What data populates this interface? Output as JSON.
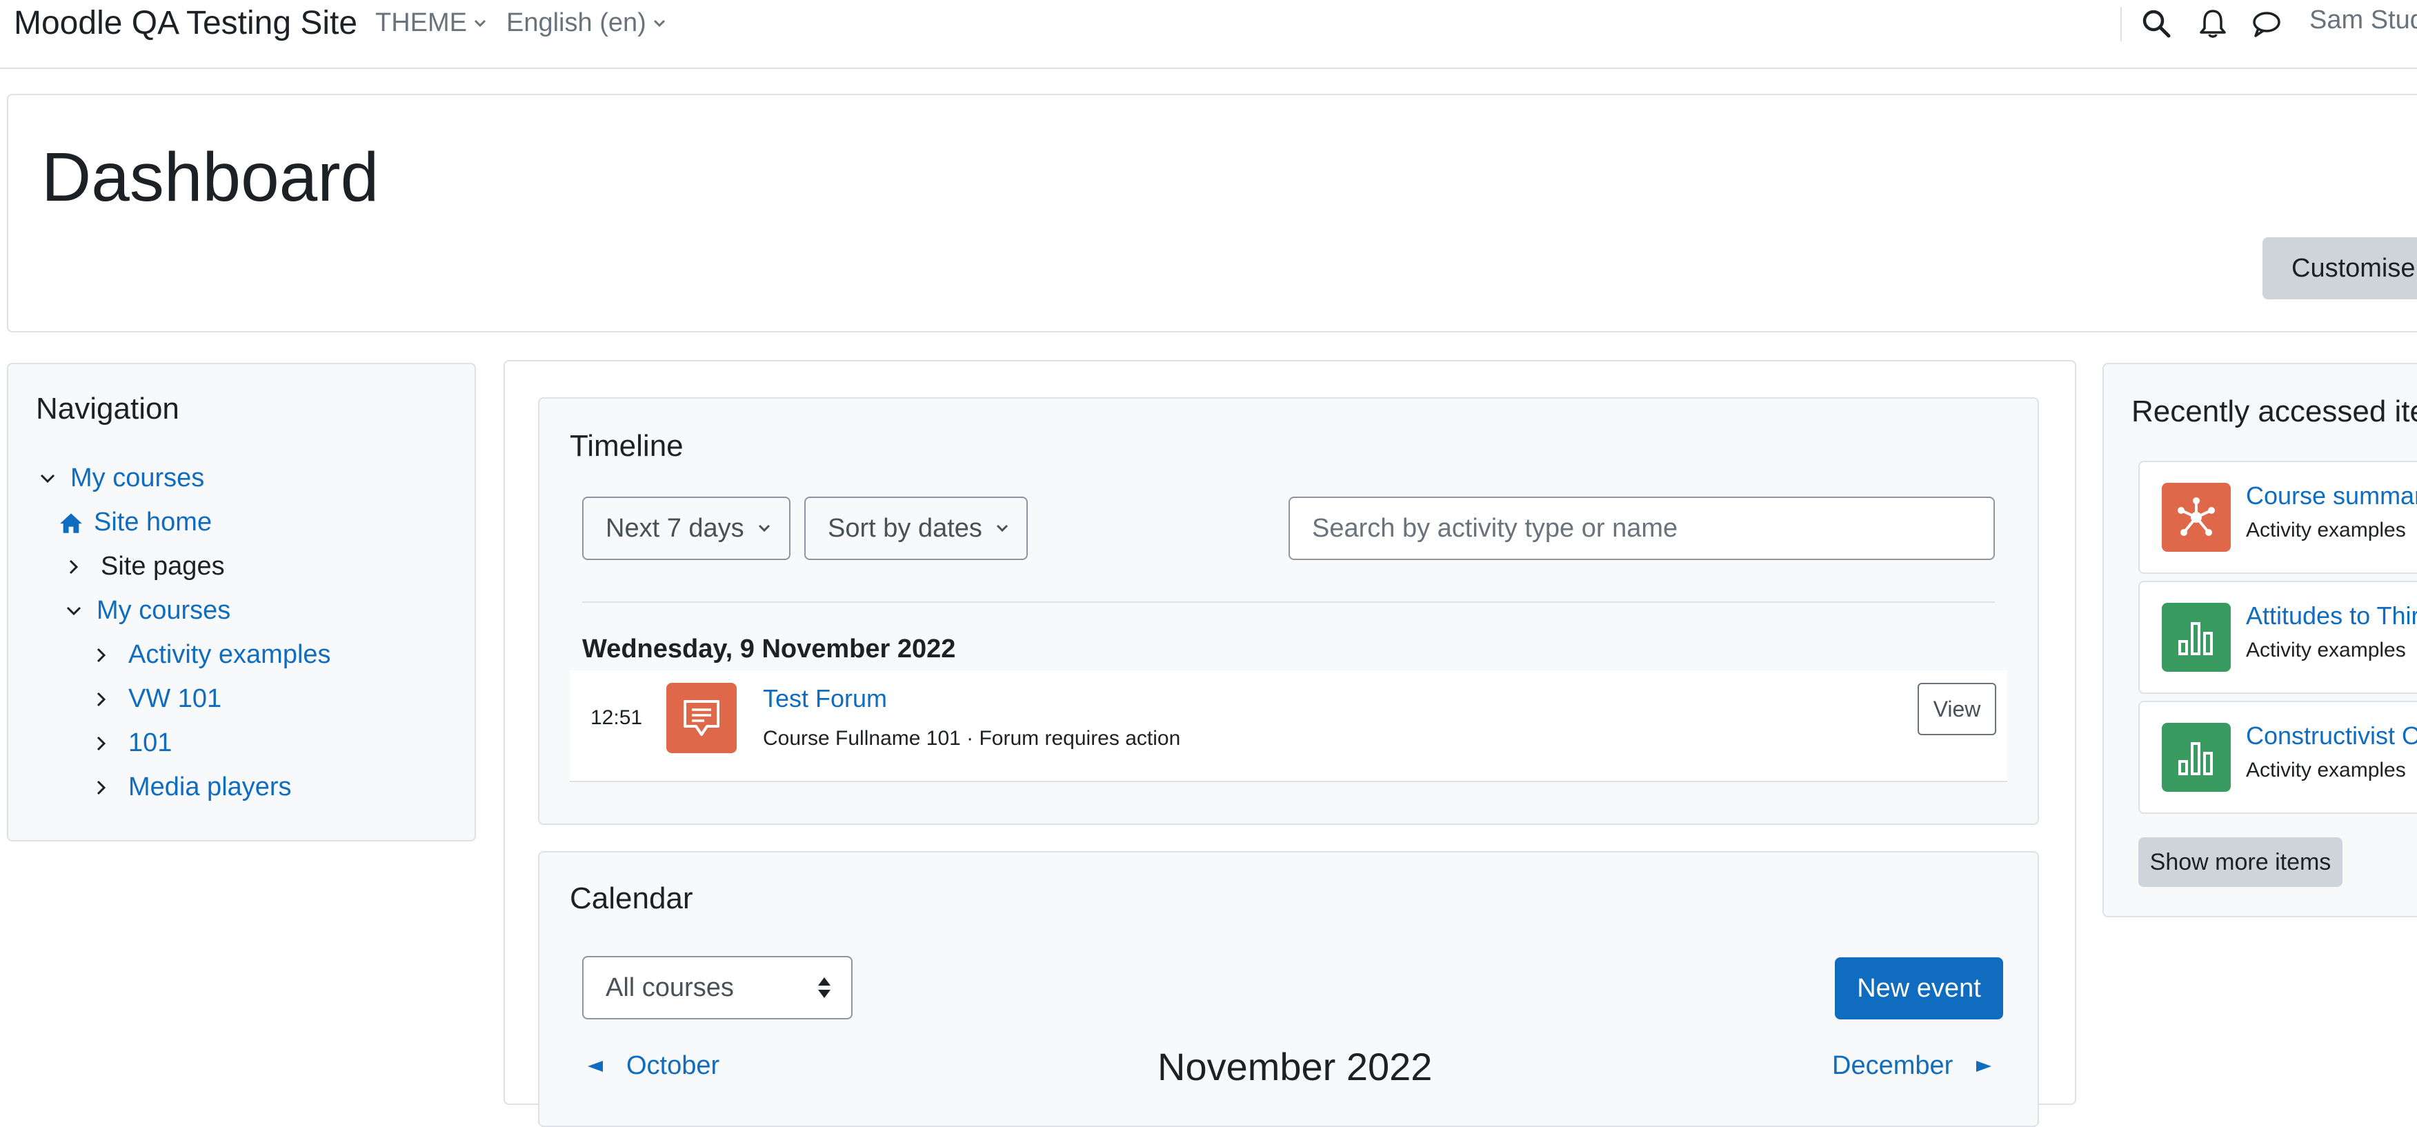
{
  "navbar": {
    "site_name": "Moodle QA Testing Site",
    "theme_menu": "THEME",
    "language_menu": "English (en)",
    "user_name": "Sam Stud"
  },
  "header": {
    "title": "Dashboard",
    "customise_button": "Customise t"
  },
  "navigation_block": {
    "title": "Navigation",
    "items": [
      {
        "label": "My courses"
      },
      {
        "label": "Site home"
      },
      {
        "label": "Site pages"
      },
      {
        "label": "My courses"
      },
      {
        "label": "Activity examples"
      },
      {
        "label": "VW 101"
      },
      {
        "label": "101"
      },
      {
        "label": "Media players"
      }
    ]
  },
  "timeline": {
    "title": "Timeline",
    "filter_label": "Next 7 days",
    "sort_label": "Sort by dates",
    "search_placeholder": "Search by activity type or name",
    "date_heading": "Wednesday, 9 November 2022",
    "events": [
      {
        "time": "12:51",
        "name": "Test Forum",
        "details": "Course Fullname 101 · Forum requires action",
        "action": "View"
      }
    ]
  },
  "calendar": {
    "title": "Calendar",
    "course_filter": "All courses",
    "new_event_button": "New event",
    "prev_month": "October",
    "current_month": "November 2022",
    "next_month": "December"
  },
  "recently_accessed": {
    "title": "Recently accessed ite",
    "items": [
      {
        "name": "Course summar",
        "course": "Activity examples",
        "icon": "network-icon"
      },
      {
        "name": "Attitudes to Thir",
        "course": "Activity examples",
        "icon": "bar-chart-icon"
      },
      {
        "name": "Constructivist O",
        "course": "Activity examples",
        "icon": "bar-chart-icon"
      }
    ],
    "show_more": "Show more items"
  },
  "colors": {
    "link": "#0f6cbf",
    "forum_icon_bg": "#e0684a",
    "feedback_icon_bg": "#399b5f",
    "primary_button": "#0f6cbf"
  }
}
